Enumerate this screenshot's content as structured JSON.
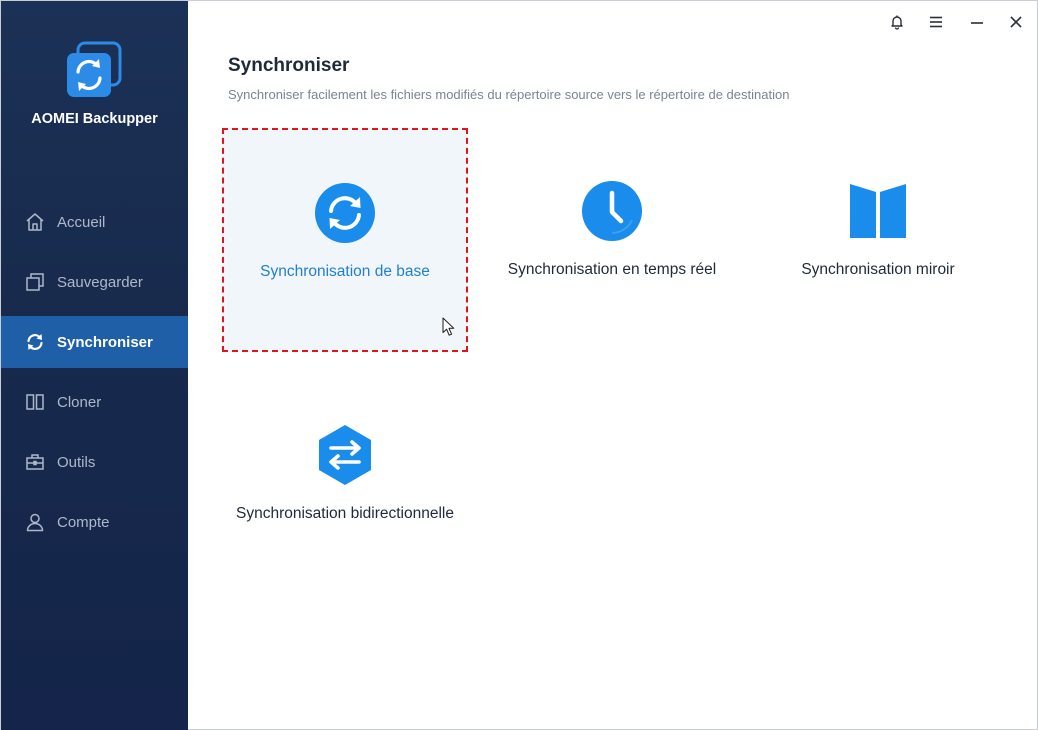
{
  "app": {
    "name": "AOMEI Backupper"
  },
  "titlebar": {
    "icons": [
      "bell-icon",
      "menu-icon",
      "minimize-icon",
      "close-icon"
    ]
  },
  "sidebar": {
    "items": [
      {
        "label": "Accueil",
        "icon": "home-icon",
        "active": false
      },
      {
        "label": "Sauvegarder",
        "icon": "backup-icon",
        "active": false
      },
      {
        "label": "Synchroniser",
        "icon": "sync-icon",
        "active": true
      },
      {
        "label": "Cloner",
        "icon": "clone-icon",
        "active": false
      },
      {
        "label": "Outils",
        "icon": "toolbox-icon",
        "active": false
      },
      {
        "label": "Compte",
        "icon": "user-icon",
        "active": false
      }
    ]
  },
  "main": {
    "title": "Synchroniser",
    "subtitle": "Synchroniser facilement les fichiers modifiés du répertoire source vers le répertoire de destination",
    "options": [
      {
        "label": "Synchronisation de base",
        "icon": "basic-sync-icon",
        "selected": true
      },
      {
        "label": "Synchronisation en temps réel",
        "icon": "clock-icon",
        "selected": false
      },
      {
        "label": "Synchronisation miroir",
        "icon": "mirror-icon",
        "selected": false
      },
      {
        "label": "Synchronisation bidirectionnelle",
        "icon": "two-way-sync-icon",
        "selected": false
      }
    ]
  },
  "colors": {
    "sidebar_bg": "#172a4c",
    "active_item": "#1f5fa8",
    "accent": "#1f7fd3",
    "selection_border": "#e0141e"
  }
}
